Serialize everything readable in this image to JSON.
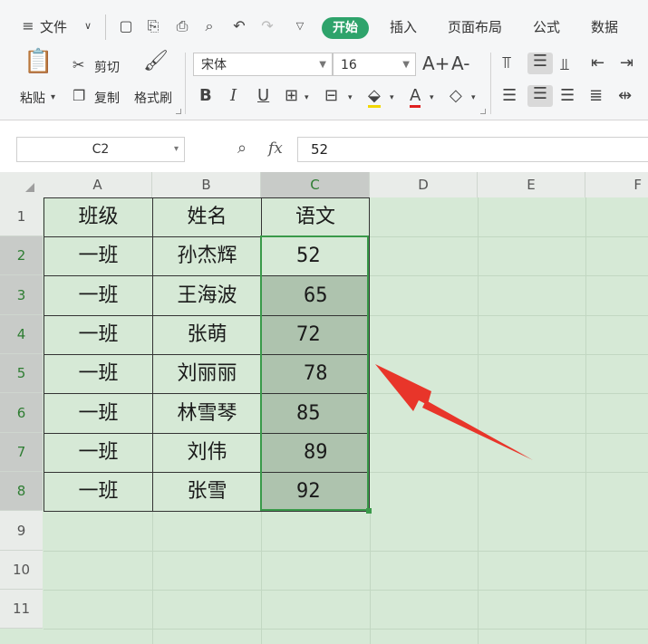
{
  "menu": {
    "hamburger_icon": "hamburger-icon",
    "file": "文件",
    "tabs": [
      "开始",
      "插入",
      "页面布局",
      "公式",
      "数据"
    ]
  },
  "ribbon": {
    "paste": "粘贴",
    "cut": "剪切",
    "copy": "复制",
    "format_painter": "格式刷",
    "font_name": "宋体",
    "font_size": "16",
    "bold": "B",
    "italic": "I",
    "underline": "U",
    "font_grow": "A+",
    "font_shrink": "A-",
    "font_color_letter": "A"
  },
  "formula_bar": {
    "name_box": "C2",
    "fx": "fx",
    "value": "52"
  },
  "sheet": {
    "columns": [
      "A",
      "B",
      "C",
      "D",
      "E",
      "F"
    ],
    "rows": [
      "1",
      "2",
      "3",
      "4",
      "5",
      "6",
      "7",
      "8",
      "9",
      "10",
      "11"
    ],
    "headers": [
      "班级",
      "姓名",
      "语文"
    ],
    "data": [
      [
        "一班",
        "孙杰辉",
        "52"
      ],
      [
        "一班",
        "王海波",
        "65"
      ],
      [
        "一班",
        "张萌",
        "72"
      ],
      [
        "一班",
        "刘丽丽",
        "78"
      ],
      [
        "一班",
        "林雪琴",
        "85"
      ],
      [
        "一班",
        "刘伟",
        "89"
      ],
      [
        "一班",
        "张雪",
        "92"
      ]
    ],
    "selected_range": "C2:C8",
    "colors": {
      "sheet_bg": "#d6e9d6",
      "selection": "#aec3ae",
      "accent": "#2ea36b",
      "arrow": "#e8352a"
    }
  }
}
